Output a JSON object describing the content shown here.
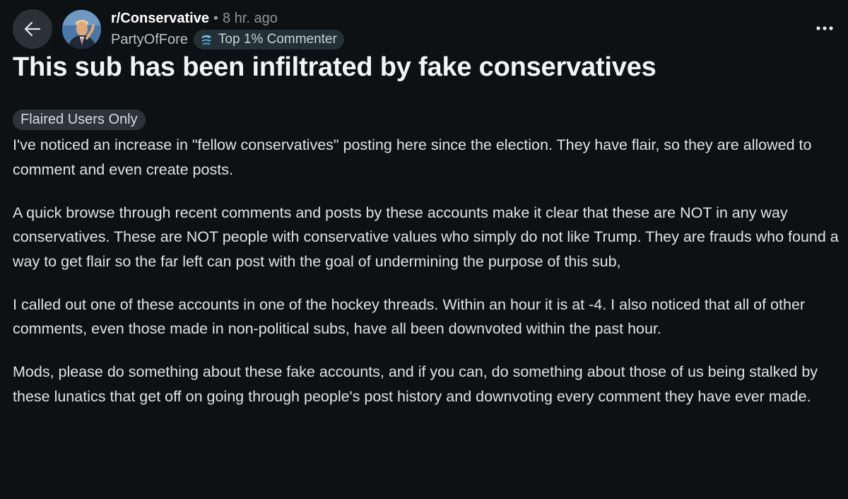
{
  "header": {
    "subreddit": "r/Conservative",
    "separator": "•",
    "time": "8 hr. ago",
    "username": "PartyOfFore",
    "badge": "Top 1% Commenter"
  },
  "icons": {
    "back": "arrow-left-icon",
    "more": "more-horizontal-icon",
    "badge": "commenter-badge-icon"
  },
  "post": {
    "title": "This sub has been infiltrated by fake conservatives",
    "flair": "Flaired Users Only",
    "paragraphs": [
      "I've noticed an increase in \"fellow conservatives\" posting here since the election. They have flair, so they are allowed to comment and even create posts.",
      "A quick browse through recent comments and posts by these accounts make it clear that these are NOT in any way conservatives. These are NOT people with conservative values who simply do not like Trump. They are frauds who found a way to get flair so the far left can post with the goal of undermining the purpose of this sub,",
      "I called out one of these accounts in one of the hockey threads. Within an hour it is at -4. I also noticed that all of other comments, even those made in non-political subs, have all been downvoted within the past hour.",
      "Mods, please do something about these fake accounts, and if you can, do something about those of us being stalked by these lunatics that get off on going through people's post history and downvoting every comment they have ever made."
    ]
  },
  "colors": {
    "background": "#0e1113",
    "button": "#2a3236",
    "badge_bg": "#233037",
    "flair_bg": "#2c3438"
  }
}
